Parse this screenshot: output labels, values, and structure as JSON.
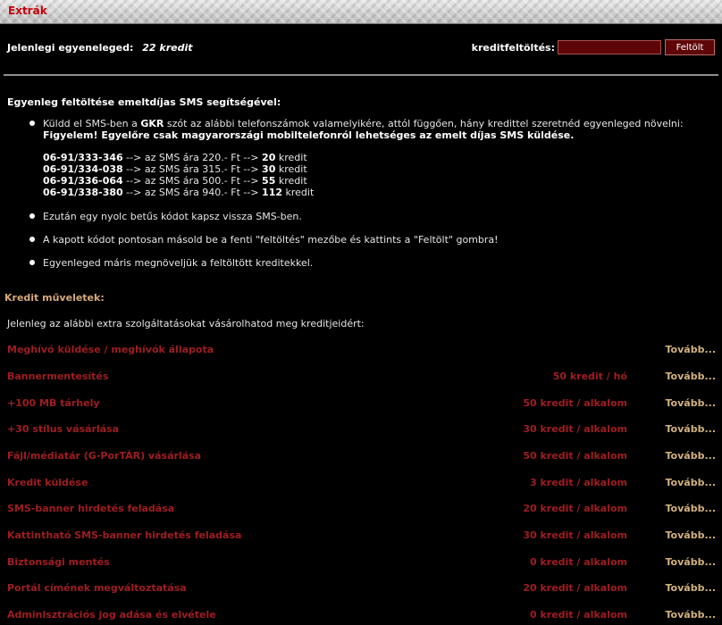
{
  "title": "Extrák",
  "balance": {
    "label": "Jelenlegi egyeneleged:",
    "value": "22 kredit"
  },
  "topup": {
    "label": "kreditfeltöltés:",
    "input_value": "",
    "button": "Feltölt"
  },
  "sms": {
    "heading": "Egyenleg feltöltése emeltdíjas SMS segítségével:",
    "bullet1_pre": "Küldd el SMS-ben a ",
    "bullet1_kw": "GKR",
    "bullet1_post": " szót az alábbi telefonszámok valamelyikére, attól függően, hány kredittel szeretnéd egyenleged növelni:",
    "bullet1_warning": "Figyelem! Egyelőre csak magyarországi mobiltelefonról lehetséges az emelt díjas SMS küldése.",
    "phones": [
      {
        "number": "06-91/333-346",
        "mid": " --> az SMS ára 220.- Ft --> ",
        "credits": "20",
        "unit": " kredit"
      },
      {
        "number": "06-91/334-038",
        "mid": " --> az SMS ára 315.- Ft --> ",
        "credits": "30",
        "unit": " kredit"
      },
      {
        "number": "06-91/336-064",
        "mid": " --> az SMS ára 500.- Ft --> ",
        "credits": "55",
        "unit": " kredit"
      },
      {
        "number": "06-91/338-380",
        "mid": " --> az SMS ára 940.- Ft --> ",
        "credits": "112",
        "unit": " kredit"
      }
    ],
    "bullet2": "Ezután egy nyolc betűs kódot kapsz vissza SMS-ben.",
    "bullet3": "A kapott kódot pontosan másold be a fenti \"feltöltés\" mezőbe és kattints a \"Feltölt\" gombra!",
    "bullet4": "Egyenleged máris megnöveljük a feltöltött kreditekkel."
  },
  "ops": {
    "heading": "Kredit műveletek:",
    "intro": "Jelenleg az alábbi extra szolgáltatásokat vásárolhatod meg kreditjeidért:",
    "more_label": "Tovább...",
    "items": [
      {
        "name": "Meghívó küldése / meghívók állapota",
        "price": ""
      },
      {
        "name": "Bannermentesítés",
        "price": "50 kredit / hó"
      },
      {
        "name": "+100 MB tárhely",
        "price": "50 kredit / alkalom"
      },
      {
        "name": "+30 stílus vásárlása",
        "price": "30 kredit / alkalom"
      },
      {
        "name": "Fájl/médiatár (G-PorTÁR) vásárlása",
        "price": "50 kredit / alkalom"
      },
      {
        "name": "Kredit küldése",
        "price": "3 kredit / alkalom"
      },
      {
        "name": "SMS-banner hirdetés feladása",
        "price": "20 kredit / alkalom"
      },
      {
        "name": "Kattintható SMS-banner hirdetés feladása",
        "price": "30 kredit / alkalom"
      },
      {
        "name": "Biztonsági mentés",
        "price": "0 kredit / alkalom"
      },
      {
        "name": "Portál címének megváltoztatása",
        "price": "20 kredit / alkalom"
      },
      {
        "name": "Adminisztrációs jog adása és elvétele",
        "price": "0 kredit / alkalom"
      }
    ]
  }
}
